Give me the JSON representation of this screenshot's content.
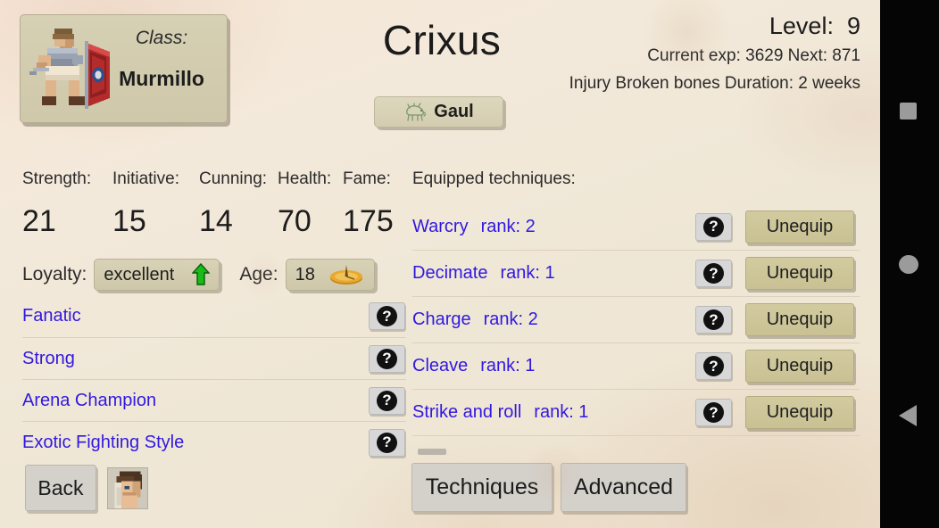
{
  "character": {
    "name": "Crixus",
    "class_label": "Class:",
    "class_value": "Murmillo",
    "origin": "Gaul",
    "origin_icon": "gaul-boar-icon",
    "class_icon": "murmillo-gladiator-sprite",
    "portrait_icon": "character-portrait-icon"
  },
  "progress": {
    "level_label": "Level:",
    "level_value": "9",
    "exp_line": "Current exp: 3629 Next: 871",
    "injury_line": "Injury  Broken bones  Duration: 2 weeks"
  },
  "stats": {
    "headers": [
      "Strength:",
      "Initiative:",
      "Cunning:",
      "Health:",
      "Fame:"
    ],
    "values": [
      "21",
      "15",
      "14",
      "70",
      "175"
    ]
  },
  "loyalty": {
    "label": "Loyalty:",
    "value": "excellent",
    "trend_icon": "green-up-arrow-icon"
  },
  "age": {
    "label": "Age:",
    "value": "18",
    "icon": "sundial-icon"
  },
  "traits": {
    "items": [
      {
        "name": "Fanatic",
        "help_label": "?"
      },
      {
        "name": "Strong",
        "help_label": "?"
      },
      {
        "name": "Arena Champion",
        "help_label": "?"
      },
      {
        "name": "Exotic Fighting Style",
        "help_label": "?"
      }
    ]
  },
  "techniques": {
    "header": "Equipped techniques:",
    "items": [
      {
        "name": "Warcry",
        "rank": "rank: 2",
        "help_label": "?",
        "action_label": "Unequip"
      },
      {
        "name": "Decimate",
        "rank": "rank: 1",
        "help_label": "?",
        "action_label": "Unequip"
      },
      {
        "name": "Charge",
        "rank": "rank: 2",
        "help_label": "?",
        "action_label": "Unequip"
      },
      {
        "name": "Cleave",
        "rank": "rank: 1",
        "help_label": "?",
        "action_label": "Unequip"
      },
      {
        "name": "Strike and roll",
        "rank": "rank: 1",
        "help_label": "?",
        "action_label": "Unequip"
      }
    ]
  },
  "footer": {
    "back_label": "Back",
    "techniques_label": "Techniques",
    "advanced_label": "Advanced"
  },
  "navbar": {
    "recents_icon": "square-recents-icon",
    "home_icon": "circle-home-icon",
    "back_icon": "triangle-back-icon"
  },
  "colors": {
    "link_blue": "#3118e0",
    "parchment": "#f3e7d6",
    "card_tan": "#d3ccb0",
    "unequip_khaki": "#cdc597",
    "gray_button": "#d4d1cb",
    "loyalty_green": "#1fb51f"
  }
}
